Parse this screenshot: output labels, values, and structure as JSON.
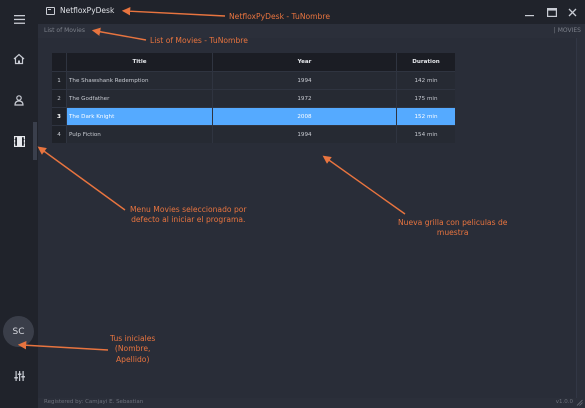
{
  "window": {
    "title": "NetfloxPyDesk",
    "minimize_icon": "minimize-icon",
    "maximize_icon": "maximize-icon",
    "close_icon": "close-icon"
  },
  "header": {
    "breadcrumb": "List of Movies",
    "section": "| MOVIES"
  },
  "sidebar": {
    "items": [
      {
        "name": "menu",
        "icon": "hamburger-menu-icon"
      },
      {
        "name": "home",
        "icon": "home-icon"
      },
      {
        "name": "users",
        "icon": "user-icon"
      },
      {
        "name": "movies",
        "icon": "film-icon",
        "active": true
      },
      {
        "name": "settings",
        "icon": "sliders-icon"
      }
    ],
    "avatar_initials": "SC"
  },
  "grid": {
    "columns": [
      "Title",
      "Year",
      "Duration"
    ],
    "rows": [
      {
        "index": "1",
        "title": "The Shawshank Redemption",
        "year": "1994",
        "duration": "142 min"
      },
      {
        "index": "2",
        "title": "The Godfather",
        "year": "1972",
        "duration": "175 min"
      },
      {
        "index": "3",
        "title": "The Dark Knight",
        "year": "2008",
        "duration": "152 min",
        "selected": true
      },
      {
        "index": "4",
        "title": "Pulp Fiction",
        "year": "1994",
        "duration": "154 min"
      }
    ],
    "selected_color": "#55aaff"
  },
  "footer": {
    "registered": "Registered by: Camjayi E. Sebastian",
    "version": "v1.0.0"
  },
  "annotations": {
    "title": "NetfloxPyDesk - TuNombre",
    "list": "List of Movies - TuNombre",
    "menu_1": "Menu Movies seleccionado por",
    "menu_2": "defecto al iniciar el programa.",
    "grid_1": "Nueva grilla con peliculas de",
    "grid_2": "muestra",
    "initials_1": "Tus iniciales",
    "initials_2": "(Nombre,",
    "initials_3": "Apellido)",
    "color": "#e8743f"
  }
}
